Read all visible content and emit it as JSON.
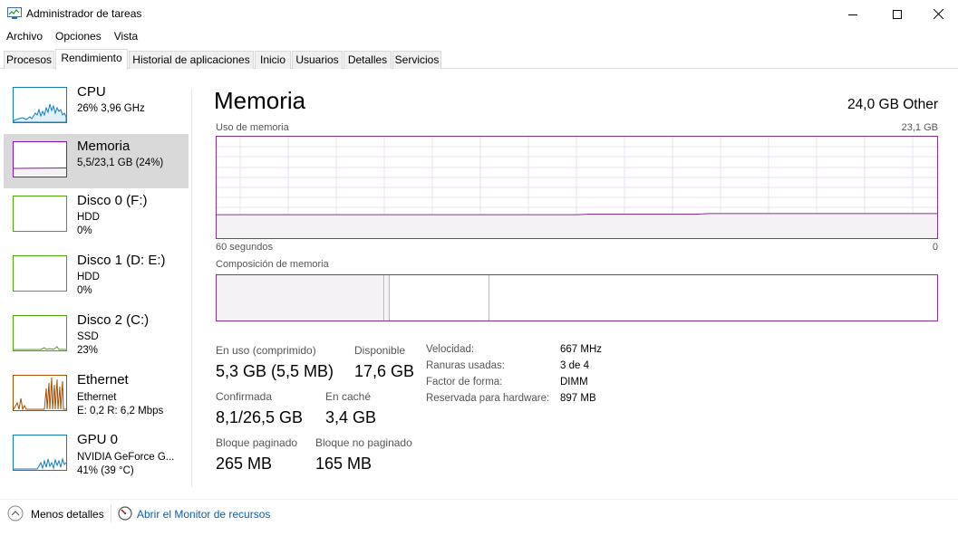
{
  "window": {
    "title": "Administrador de tareas",
    "icons": {
      "app": "task-manager-icon",
      "minimize": "minimize-icon",
      "maximize": "maximize-icon",
      "close": "close-icon"
    }
  },
  "menu": [
    "Archivo",
    "Opciones",
    "Vista"
  ],
  "tabs": [
    "Procesos",
    "Rendimiento",
    "Historial de aplicaciones",
    "Inicio",
    "Usuarios",
    "Detalles",
    "Servicios"
  ],
  "active_tab": "Rendimiento",
  "sidebar": {
    "items": [
      {
        "title": "CPU",
        "lines": [
          "26%  3,96 GHz"
        ],
        "color": "#117dbb"
      },
      {
        "title": "Memoria",
        "lines": [
          "5,5/23,1 GB (24%)"
        ],
        "color": "#8b12ae"
      },
      {
        "title": "Disco 0 (F:)",
        "lines": [
          "HDD",
          "0%"
        ],
        "color": "#4da60c"
      },
      {
        "title": "Disco 1 (D: E:)",
        "lines": [
          "HDD",
          "0%"
        ],
        "color": "#4da60c"
      },
      {
        "title": "Disco 2 (C:)",
        "lines": [
          "SSD",
          "23%"
        ],
        "color": "#4da60c"
      },
      {
        "title": "Ethernet",
        "lines": [
          "Ethernet",
          "E: 0,2  R: 6,2 Mbps"
        ],
        "color": "#a74f01"
      },
      {
        "title": "GPU 0",
        "lines": [
          "NVIDIA GeForce G...",
          "41% (39 °C)"
        ],
        "color": "#117dbb"
      }
    ],
    "selected": 1
  },
  "main": {
    "title": "Memoria",
    "total": "24,0 GB Other",
    "usage_label": "Uso de memoria",
    "usage_max": "23,1 GB",
    "time_left": "60 segundos",
    "time_right": "0",
    "composition_label": "Composición de memoria",
    "usage_level": 0.24,
    "stats": {
      "in_use_label": "En uso (comprimido)",
      "in_use_value": "5,3 GB (5,5 MB)",
      "available_label": "Disponible",
      "available_value": "17,6 GB",
      "committed_label": "Confirmada",
      "committed_value": "8,1/26,5 GB",
      "cached_label": "En caché",
      "cached_value": "3,4 GB",
      "paged_label": "Bloque paginado",
      "paged_value": "265 MB",
      "nonpaged_label": "Bloque no paginado",
      "nonpaged_value": "165 MB"
    },
    "properties": [
      {
        "label": "Velocidad:",
        "value": "667 MHz"
      },
      {
        "label": "Ranuras usadas:",
        "value": "3 de 4"
      },
      {
        "label": "Factor de forma:",
        "value": "DIMM"
      },
      {
        "label": "Reservada para hardware:",
        "value": "897 MB"
      }
    ]
  },
  "footer": {
    "less_details": "Menos detalles",
    "resource_monitor": "Abrir el Monitor de recursos"
  },
  "colors": {
    "memory_accent": "#8b2f95",
    "memory_fill": "#f4f2f4",
    "link": "#0d5ea8"
  }
}
